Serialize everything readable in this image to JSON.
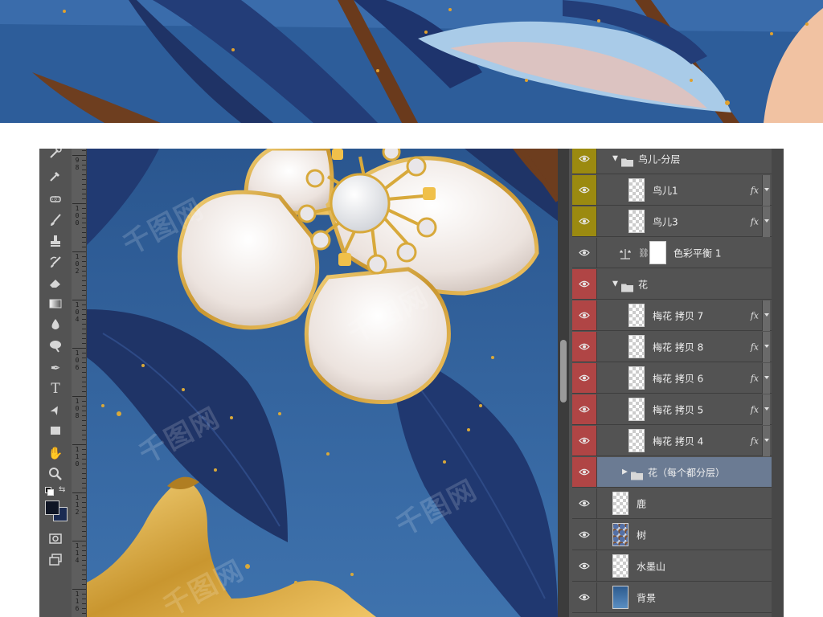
{
  "colors": {
    "canvas_blue": "#2f5e99",
    "leaf_navy": "#223a70",
    "gold": "#d9a93a",
    "panel_bg": "#535353",
    "group_olive": "#9b8a10",
    "group_red": "#b04545",
    "selected_row": "#6b7b93"
  },
  "ruler": {
    "marks": [
      "98",
      "100",
      "102",
      "104",
      "106",
      "108",
      "110",
      "112",
      "114",
      "116"
    ]
  },
  "tools": [
    {
      "name": "quick-selection-tool-icon"
    },
    {
      "name": "eyedropper-tool-icon"
    },
    {
      "name": "spot-healing-tool-icon"
    },
    {
      "name": "brush-tool-icon"
    },
    {
      "name": "clone-stamp-tool-icon"
    },
    {
      "name": "history-brush-tool-icon"
    },
    {
      "name": "eraser-tool-icon"
    },
    {
      "name": "gradient-tool-icon"
    },
    {
      "name": "blur-tool-icon"
    },
    {
      "name": "dodge-tool-icon"
    },
    {
      "name": "pen-tool-icon",
      "glyph": "✒"
    },
    {
      "name": "type-tool-icon",
      "glyph": "T"
    },
    {
      "name": "path-selection-tool-icon",
      "glyph": "➤"
    },
    {
      "name": "rectangle-tool-icon"
    },
    {
      "name": "hand-tool-icon",
      "glyph": "✋"
    },
    {
      "name": "zoom-tool-icon"
    }
  ],
  "layers": [
    {
      "name": "鸟儿-分层",
      "kind": "group",
      "indent": 1,
      "expanded": true,
      "tint": "olive"
    },
    {
      "name": "鸟儿1",
      "kind": "layer",
      "indent": 2,
      "fx": "fx",
      "tint": "olive"
    },
    {
      "name": "鸟儿3",
      "kind": "layer",
      "indent": 2,
      "fx": "fx",
      "tint": "olive"
    },
    {
      "name": "色彩平衡 1",
      "kind": "adjustment",
      "indent": 1
    },
    {
      "name": "花",
      "kind": "group",
      "indent": 1,
      "expanded": true,
      "tint": "red"
    },
    {
      "name": "梅花 拷贝 7",
      "kind": "layer",
      "indent": 2,
      "fx": "fx",
      "tint": "red"
    },
    {
      "name": "梅花 拷贝 8",
      "kind": "layer",
      "indent": 2,
      "fx": "fx",
      "tint": "red"
    },
    {
      "name": "梅花 拷贝 6",
      "kind": "layer",
      "indent": 2,
      "fx": "fx",
      "tint": "red"
    },
    {
      "name": "梅花 拷贝 5",
      "kind": "layer",
      "indent": 2,
      "fx": "fx",
      "tint": "red"
    },
    {
      "name": "梅花 拷贝 4",
      "kind": "layer",
      "indent": 2,
      "fx": "fx",
      "tint": "red"
    },
    {
      "name": "花（每个都分层）",
      "kind": "group",
      "indent": 2,
      "expanded": false,
      "selected": true,
      "tint": "red"
    },
    {
      "name": "鹿",
      "kind": "layer",
      "indent": 0
    },
    {
      "name": "树",
      "kind": "layer",
      "indent": 0,
      "thumb": "tree"
    },
    {
      "name": "水墨山",
      "kind": "layer",
      "indent": 0
    },
    {
      "name": "背景",
      "kind": "layer",
      "indent": 0,
      "thumb": "bg"
    }
  ]
}
